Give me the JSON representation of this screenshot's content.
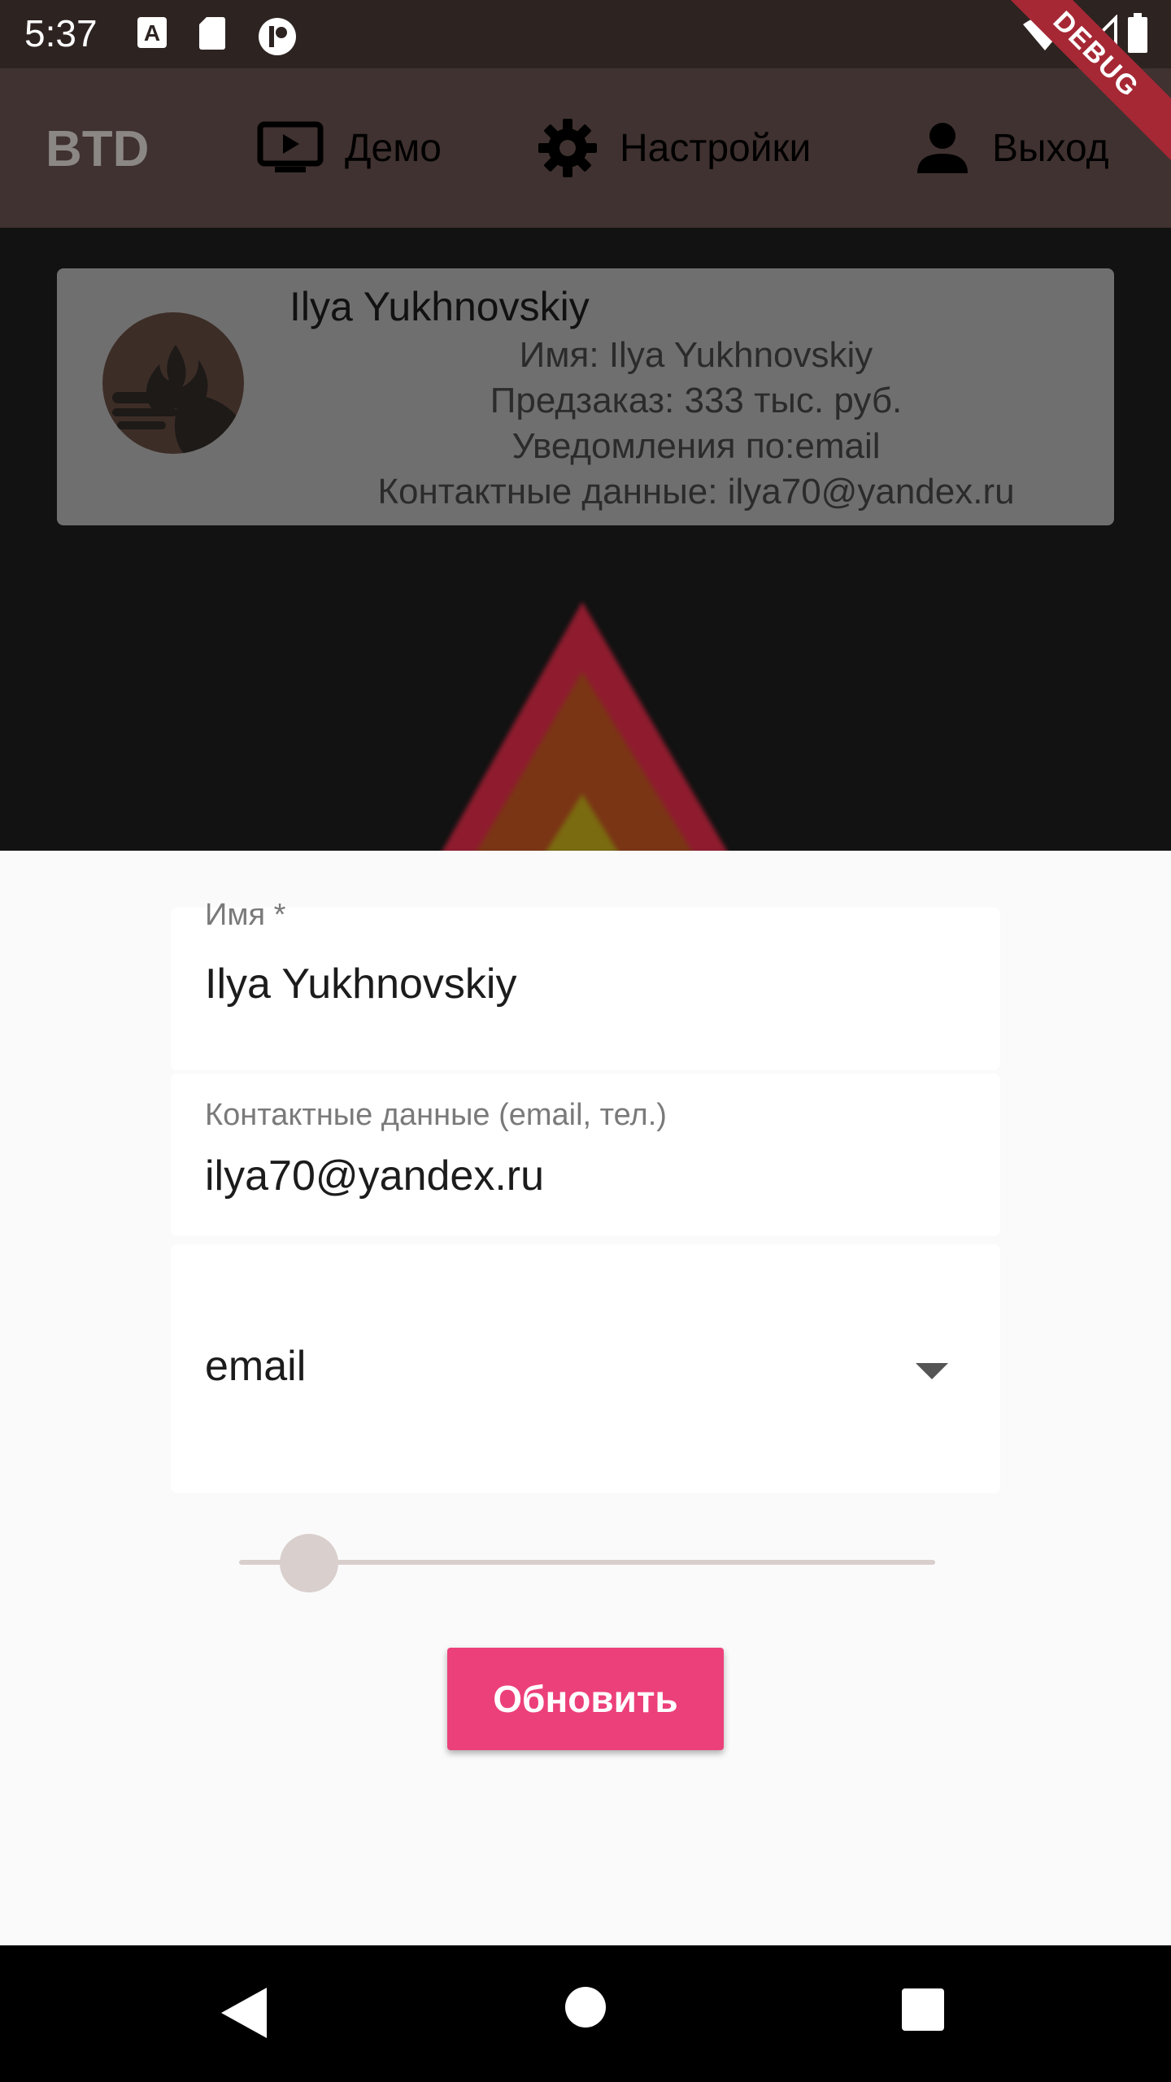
{
  "status_bar": {
    "time": "5:37",
    "icons": [
      "a-icon",
      "sd-card-icon",
      "circle-app-icon",
      "wifi-icon",
      "signal-icon",
      "battery-icon"
    ],
    "debug_label": "DEBUG"
  },
  "app_bar": {
    "title": "BTD",
    "actions": [
      {
        "label": "Демо",
        "icon": "tv-play-icon"
      },
      {
        "label": "Настройки",
        "icon": "gear-icon"
      },
      {
        "label": "Выход",
        "icon": "person-icon"
      }
    ]
  },
  "profile_card": {
    "name": "Ilya Yukhnovskiy",
    "lines": [
      "Имя: Ilya Yukhnovskiy",
      "Предзаказ: 333 тыс. руб.",
      "Уведомления по:email",
      "Контактные данные: ilya70@yandex.ru"
    ]
  },
  "form": {
    "name_field": {
      "label": "Имя *",
      "value": "Ilya Yukhnovskiy"
    },
    "contact_field": {
      "label": "Контактные данные (email, тел.)",
      "value": "ilya70@yandex.ru"
    },
    "notify_dropdown": {
      "selected": "email"
    },
    "slider": {
      "value_fraction": 0.1
    },
    "submit_label": "Обновить"
  },
  "colors": {
    "accent": "#ec407a",
    "app_bar": "#403230",
    "status_bar": "#2d2321"
  }
}
